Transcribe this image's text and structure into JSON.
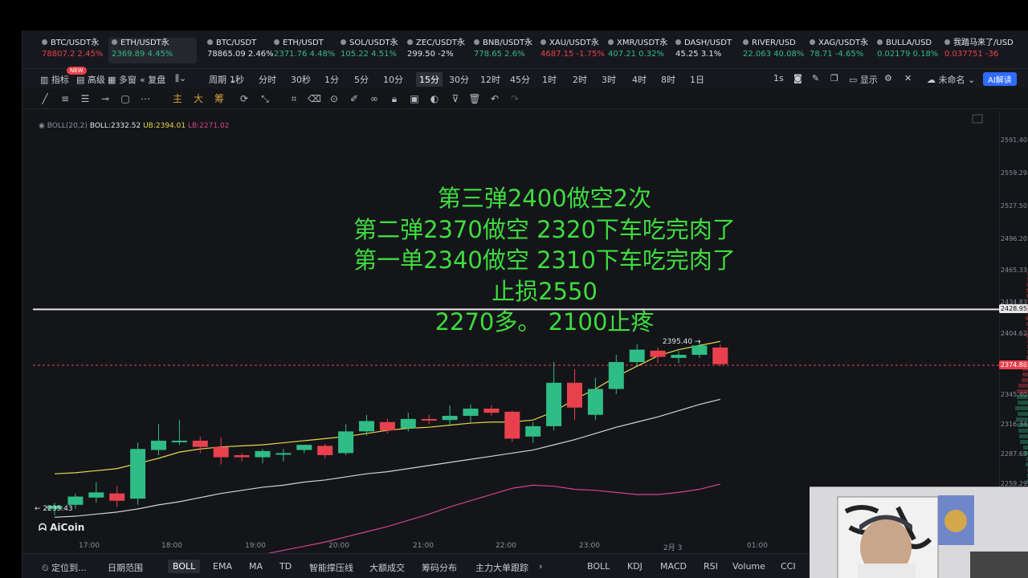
{
  "tickers": [
    {
      "symbol": "BTC/USDT永续",
      "price": "78807.2",
      "change": "2.45%",
      "dir": "down"
    },
    {
      "symbol": "ETH/USDT永续",
      "price": "2369.89",
      "change": "4.45%",
      "dir": "up",
      "active": true
    },
    {
      "symbol": "BTC/USDT",
      "price": "78865.09",
      "change": "2.46%",
      "dir": "neutral"
    },
    {
      "symbol": "ETH/USDT",
      "price": "2371.76",
      "change": "4.48%",
      "dir": "up"
    },
    {
      "symbol": "SOL/USDT永续",
      "price": "105.22",
      "change": "4.51%",
      "dir": "up"
    },
    {
      "symbol": "ZEC/USDT永续",
      "price": "299.50",
      "change": "-2%",
      "dir": "neutral"
    },
    {
      "symbol": "BNB/USDT永续",
      "price": "778.65",
      "change": "2.6%",
      "dir": "up"
    },
    {
      "symbol": "XAU/USDT永续",
      "price": "4687.15",
      "change": "-1.75%",
      "dir": "down"
    },
    {
      "symbol": "XMR/USDT永续",
      "price": "407.21",
      "change": "0.32%",
      "dir": "up"
    },
    {
      "symbol": "DASH/USDT",
      "price": "45.25",
      "change": "3.1%",
      "dir": "neutral"
    },
    {
      "symbol": "RIVER/USDT",
      "price": "22.063",
      "change": "40.08%",
      "dir": "up"
    },
    {
      "symbol": "XAG/USDT永续",
      "price": "78.71",
      "change": "-4.65%",
      "dir": "up"
    },
    {
      "symbol": "BULLA/USDT",
      "price": "0.02179",
      "change": "0.18%",
      "dir": "up"
    },
    {
      "symbol": "我踏马来了/USDT",
      "price": "0.037751",
      "change": "-36",
      "dir": "down"
    }
  ],
  "toolbar": {
    "indicators": "指标",
    "new_badge": "NEW",
    "advanced": "高级",
    "multi_window": "多窗",
    "replay": "复盘",
    "period": "周期",
    "intervals": [
      "1秒",
      "分时",
      "30秒",
      "1分",
      "5分",
      "10分",
      "15分",
      "30分",
      "12时",
      "45分",
      "1时",
      "2时",
      "3时",
      "4时",
      "8时",
      "1日"
    ],
    "selected_interval": "15分",
    "right": {
      "refresh": "1s",
      "display": "显示",
      "unnamed": "未命名",
      "ai": "AI解读"
    }
  },
  "drawing_tools": {
    "main": "主",
    "big": "大",
    "chips": "筹"
  },
  "boll_legend": {
    "name": "BOLL(20,2)",
    "mid": "BOLL:2332.52",
    "ub": "UB:2394.01",
    "lb": "LB:2271.02"
  },
  "overlay_text": [
    "第三弹2400做空2次",
    "第二弹2370做空 2320下车吃完肉了",
    "第一单2340做空 2310下车吃完肉了",
    "止损2550",
    "2270多。 2100止疼"
  ],
  "y_axis_ticks": [
    "2591.40",
    "2559.29",
    "2527.50",
    "2496.20",
    "2465.33",
    "2434.83",
    "2404.62",
    "2374.83",
    "2345.40",
    "2316.34",
    "2287.63",
    "2259.29"
  ],
  "price_tags": {
    "horizontal_line": "2428.95",
    "last_price": "2374.88",
    "high_label": "2395.40",
    "low_label": "2235.43"
  },
  "x_axis_ticks": [
    "17:00",
    "18:00",
    "19:00",
    "20:00",
    "21:00",
    "22:00",
    "23:00",
    "2月 3",
    "01:00"
  ],
  "watermark": "AiCoin",
  "bottom_bar": {
    "left": [
      "定位到...",
      "日期范围"
    ],
    "main_indicators": [
      "BOLL",
      "EMA",
      "MA",
      "TD",
      "智能撑压线",
      "大额成交",
      "筹码分布",
      "主力大单跟踪"
    ],
    "sub_indicators": [
      "BOLL",
      "KDJ",
      "MACD",
      "RSI",
      "Volume",
      "CCI"
    ],
    "selected_main": "BOLL"
  },
  "chart_data": {
    "type": "candlestick",
    "interval": "15分",
    "candles": [
      {
        "o": 2236,
        "h": 2242,
        "l": 2230,
        "c": 2239
      },
      {
        "o": 2240,
        "h": 2251,
        "l": 2236,
        "c": 2248
      },
      {
        "o": 2247,
        "h": 2262,
        "l": 2242,
        "c": 2252
      },
      {
        "o": 2251,
        "h": 2258,
        "l": 2238,
        "c": 2244
      },
      {
        "o": 2246,
        "h": 2300,
        "l": 2240,
        "c": 2294
      },
      {
        "o": 2293,
        "h": 2318,
        "l": 2288,
        "c": 2302
      },
      {
        "o": 2302,
        "h": 2322,
        "l": 2298,
        "c": 2302
      },
      {
        "o": 2302,
        "h": 2306,
        "l": 2290,
        "c": 2296
      },
      {
        "o": 2296,
        "h": 2305,
        "l": 2279,
        "c": 2286
      },
      {
        "o": 2288,
        "h": 2290,
        "l": 2282,
        "c": 2286
      },
      {
        "o": 2286,
        "h": 2294,
        "l": 2280,
        "c": 2292
      },
      {
        "o": 2290,
        "h": 2294,
        "l": 2282,
        "c": 2290
      },
      {
        "o": 2293,
        "h": 2298,
        "l": 2290,
        "c": 2298
      },
      {
        "o": 2297,
        "h": 2299,
        "l": 2285,
        "c": 2288
      },
      {
        "o": 2290,
        "h": 2318,
        "l": 2288,
        "c": 2311
      },
      {
        "o": 2311,
        "h": 2327,
        "l": 2307,
        "c": 2321
      },
      {
        "o": 2320,
        "h": 2323,
        "l": 2309,
        "c": 2312
      },
      {
        "o": 2314,
        "h": 2329,
        "l": 2311,
        "c": 2323
      },
      {
        "o": 2323,
        "h": 2327,
        "l": 2318,
        "c": 2322
      },
      {
        "o": 2322,
        "h": 2336,
        "l": 2316,
        "c": 2326
      },
      {
        "o": 2326,
        "h": 2337,
        "l": 2320,
        "c": 2333
      },
      {
        "o": 2333,
        "h": 2336,
        "l": 2326,
        "c": 2329
      },
      {
        "o": 2330,
        "h": 2331,
        "l": 2301,
        "c": 2304
      },
      {
        "o": 2306,
        "h": 2320,
        "l": 2300,
        "c": 2316
      },
      {
        "o": 2316,
        "h": 2378,
        "l": 2312,
        "c": 2358
      },
      {
        "o": 2358,
        "h": 2371,
        "l": 2322,
        "c": 2334
      },
      {
        "o": 2327,
        "h": 2363,
        "l": 2322,
        "c": 2352
      },
      {
        "o": 2352,
        "h": 2385,
        "l": 2347,
        "c": 2378
      },
      {
        "o": 2378,
        "h": 2395.4,
        "l": 2374,
        "c": 2390
      },
      {
        "o": 2389,
        "h": 2392,
        "l": 2377,
        "c": 2383
      },
      {
        "o": 2382,
        "h": 2389,
        "l": 2377,
        "c": 2385
      },
      {
        "o": 2385,
        "h": 2398,
        "l": 2382,
        "c": 2394
      },
      {
        "o": 2392,
        "h": 2395,
        "l": 2374,
        "c": 2376
      }
    ],
    "boll_mid": [
      2250,
      2252,
      2253,
      2255,
      2262,
      2268,
      2276,
      2283,
      2290,
      2294,
      2296,
      2298,
      2300,
      2302,
      2305,
      2308,
      2310,
      2312,
      2313,
      2314,
      2316,
      2318,
      2318,
      2320,
      2326,
      2332,
      2340,
      2349,
      2357,
      2364,
      2370,
      2376,
      2380
    ],
    "boll_ub": [
      2270,
      2271,
      2273,
      2275,
      2280,
      2285,
      2291,
      2294,
      2296,
      2297,
      2298,
      2300,
      2302,
      2304,
      2306,
      2309,
      2312,
      2314,
      2315,
      2317,
      2319,
      2320,
      2320,
      2322,
      2330,
      2342,
      2352,
      2364,
      2374,
      2384,
      2390,
      2394,
      2398
    ],
    "boll_lb": [
      2228,
      2229,
      2231,
      2233,
      2236,
      2240,
      2243,
      2247,
      2251,
      2254,
      2257,
      2259,
      2262,
      2264,
      2267,
      2270,
      2272,
      2275,
      2278,
      2281,
      2284,
      2287,
      2290,
      2293,
      2298,
      2303,
      2309,
      2315,
      2320,
      2325,
      2331,
      2337,
      2342
    ],
    "boll_lb_display": [
      2159,
      2161,
      2163,
      2165,
      2168,
      2172,
      2176,
      2180,
      2184,
      2188,
      2192,
      2196,
      2200,
      2204,
      2209,
      2214,
      2219,
      2225,
      2231,
      2238,
      2244,
      2250,
      2256,
      2259,
      2258,
      2255,
      2254,
      2252,
      2250,
      2250,
      2252,
      2255,
      2260
    ],
    "horizontal_line": 2428.95,
    "last_price": 2374.88,
    "ylim": [
      2240,
      2600
    ],
    "colors": {
      "up": "#2ebd85",
      "down": "#e8414d",
      "mid": "#cfd3dc",
      "ub": "#e6d84a",
      "lb": "#d0448b"
    }
  }
}
